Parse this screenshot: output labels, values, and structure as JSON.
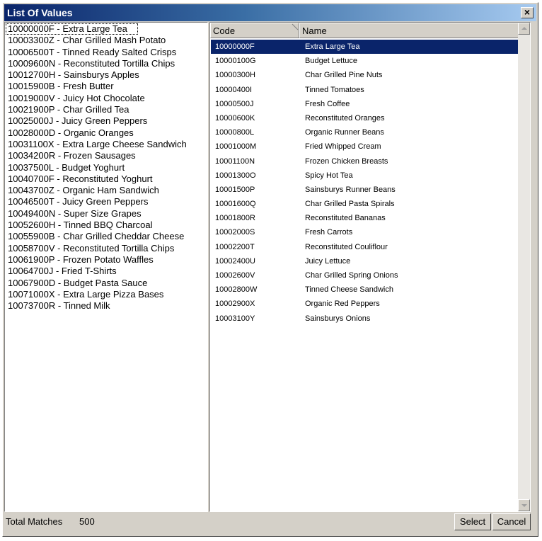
{
  "window": {
    "title": "List Of Values",
    "close_label": "×"
  },
  "left_list": {
    "items": [
      "10000000F - Extra Large Tea",
      "10003300Z - Char Grilled Mash Potato",
      "10006500T - Tinned Ready Salted Crisps",
      "10009600N - Reconstituted Tortilla Chips",
      "10012700H - Sainsburys Apples",
      "10015900B - Fresh Butter",
      "10019000V - Juicy Hot Chocolate",
      "10021900P - Char Grilled Tea",
      "10025000J - Juicy Green Peppers",
      "10028000D - Organic Oranges",
      "10031100X - Extra Large Cheese Sandwich",
      "10034200R - Frozen Sausages",
      "10037500L - Budget Yoghurt",
      "10040700F - Reconstituted Yoghurt",
      "10043700Z - Organic Ham Sandwich",
      "10046500T - Juicy Green Peppers",
      "10049400N - Super Size Grapes",
      "10052600H - Tinned BBQ Charcoal",
      "10055900B - Char Grilled Cheddar Cheese",
      "10058700V - Reconstituted Tortilla Chips",
      "10061900P - Frozen Potato Waffles",
      "10064700J - Fried T-Shirts",
      "10067900D - Budget Pasta Sauce",
      "10071000X - Extra Large Pizza Bases",
      "10073700R - Tinned Milk"
    ]
  },
  "grid": {
    "headers": {
      "code": "Code",
      "name": "Name"
    },
    "rows": [
      {
        "code": "10000000F",
        "name": "Extra Large Tea"
      },
      {
        "code": "10000100G",
        "name": "Budget Lettuce"
      },
      {
        "code": "10000300H",
        "name": "Char Grilled Pine Nuts"
      },
      {
        "code": "10000400I",
        "name": "Tinned Tomatoes"
      },
      {
        "code": "10000500J",
        "name": "Fresh Coffee"
      },
      {
        "code": "10000600K",
        "name": "Reconstituted Oranges"
      },
      {
        "code": "10000800L",
        "name": "Organic Runner Beans"
      },
      {
        "code": "10001000M",
        "name": "Fried Whipped Cream"
      },
      {
        "code": "10001100N",
        "name": "Frozen Chicken Breasts"
      },
      {
        "code": "10001300O",
        "name": "Spicy Hot Tea"
      },
      {
        "code": "10001500P",
        "name": "Sainsburys Runner Beans"
      },
      {
        "code": "10001600Q",
        "name": "Char Grilled Pasta Spirals"
      },
      {
        "code": "10001800R",
        "name": "Reconstituted Bananas"
      },
      {
        "code": "10002000S",
        "name": "Fresh Carrots"
      },
      {
        "code": "10002200T",
        "name": "Reconstituted Couliflour"
      },
      {
        "code": "10002400U",
        "name": "Juicy Lettuce"
      },
      {
        "code": "10002600V",
        "name": "Char Grilled Spring Onions"
      },
      {
        "code": "10002800W",
        "name": "Tinned Cheese Sandwich"
      },
      {
        "code": "10002900X",
        "name": "Organic Red Peppers"
      },
      {
        "code": "10003100Y",
        "name": "Sainsburys Onions"
      }
    ]
  },
  "status": {
    "total_label": "Total Matches",
    "total_value": "500"
  },
  "buttons": {
    "select": "Select",
    "cancel": "Cancel"
  },
  "colors": {
    "selection": "#0a246a",
    "title_start": "#0a246a",
    "title_end": "#a6caf0",
    "face": "#d4d0c8"
  }
}
